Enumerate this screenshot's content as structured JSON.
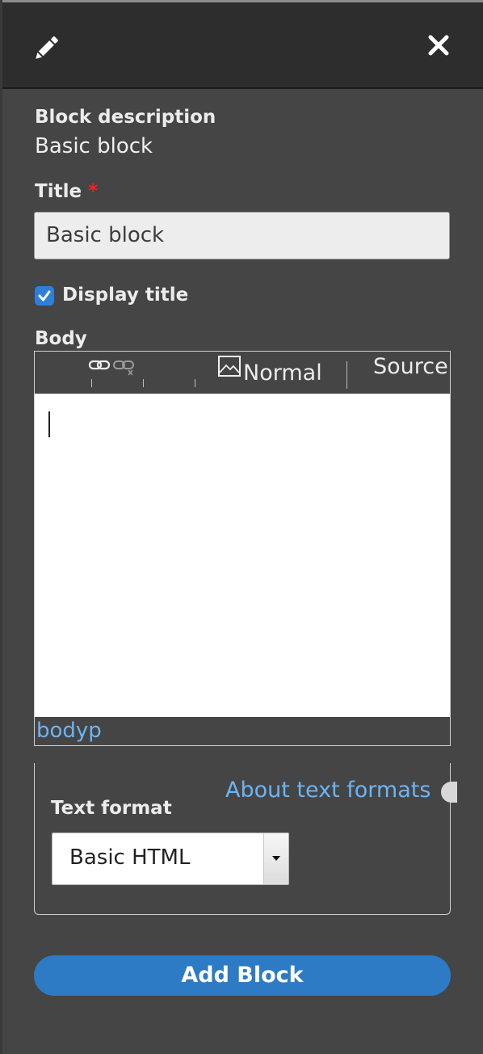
{
  "header": {
    "edit_icon": "pencil-icon",
    "close_icon": "close-icon"
  },
  "form": {
    "block_description_label": "Block description",
    "block_description_value": "Basic block",
    "title_label": "Title",
    "title_required": "*",
    "title_value": "Basic block",
    "display_title_label": "Display title",
    "display_title_checked": true,
    "body_label": "Body"
  },
  "editor": {
    "toolbar": {
      "link_icon": "link-icon",
      "unlink_icon": "unlink-icon",
      "image_icon": "image-icon",
      "format_value": "Normal",
      "source_label": "Source"
    },
    "element_path": "bodyp"
  },
  "text_format": {
    "about_link": "About text formats",
    "label": "Text format",
    "selected": "Basic HTML"
  },
  "actions": {
    "add_block": "Add Block"
  },
  "colors": {
    "panel_bg": "#454545",
    "header_bg": "#2d2d2d",
    "link": "#6cb4f3",
    "primary_button": "#2d7bc4",
    "required": "#ee2222"
  }
}
